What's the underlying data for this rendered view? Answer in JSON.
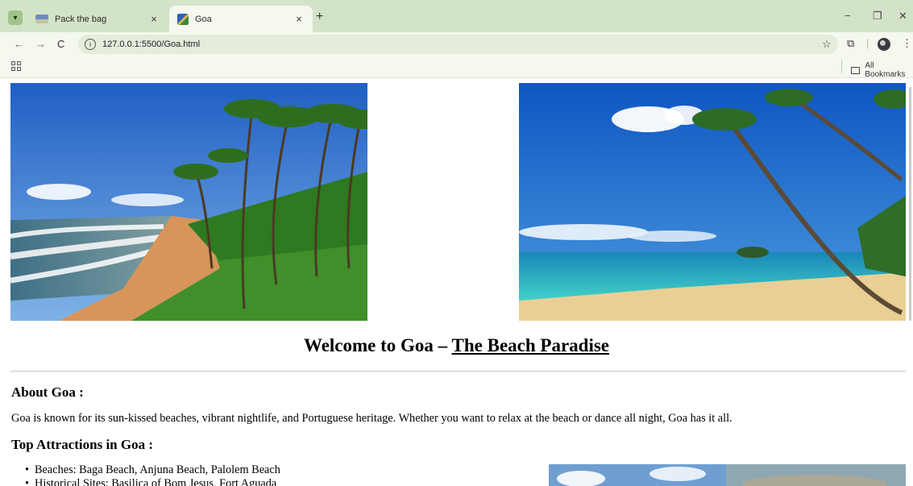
{
  "browser": {
    "tabs": [
      {
        "title": "Pack the bag",
        "active": false
      },
      {
        "title": "Goa",
        "active": true
      }
    ],
    "address": "127.0.0.1:5500/Goa.html",
    "bookmarks_label": "All Bookmarks",
    "icons": [
      "chevron-down-icon",
      "close-icon",
      "plus-icon",
      "back-icon",
      "forward-icon",
      "reload-icon",
      "site-info-icon",
      "star-icon",
      "extensions-icon",
      "profile-icon",
      "more-icon",
      "apps-icon",
      "folder-icon",
      "minimize-icon",
      "restore-icon"
    ]
  },
  "page": {
    "heading_prefix": "Welcome to Goa – ",
    "heading_link": "The Beach Paradise",
    "about_heading": "About Goa :",
    "about_text": "Goa is known for its sun-kissed beaches, vibrant nightlife, and Portuguese heritage. Whether you want to relax at the beach or dance all night, Goa has it all.",
    "attractions_heading": "Top Attractions in Goa :",
    "attractions": [
      "Beaches: Baga Beach, Anjuna Beach, Palolem Beach",
      "Historical Sites: Basilica of Bom Jesus, Fort Aguada"
    ]
  },
  "colors": {
    "tabbar": "#d3e3c8",
    "toolbar": "#f4f8ee",
    "omnibox": "#e4ecdb"
  }
}
